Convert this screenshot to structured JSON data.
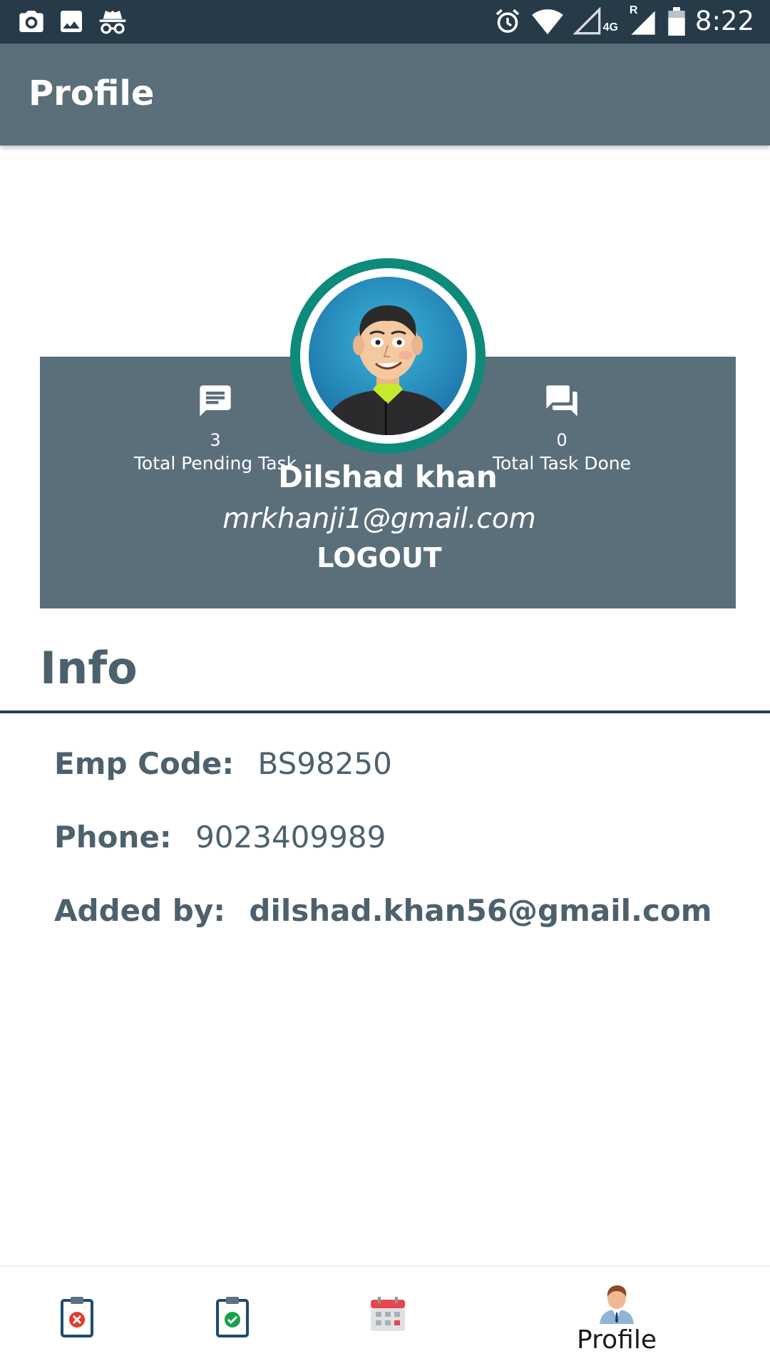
{
  "status_bar": {
    "time": "8:22",
    "network": "4G",
    "roaming": "R",
    "icons": [
      "camera-icon",
      "image-icon",
      "incognito-icon",
      "alarm-icon",
      "wifi-icon",
      "signal-icon",
      "roaming-signal-icon",
      "battery-icon"
    ]
  },
  "app_bar": {
    "title": "Profile"
  },
  "profile": {
    "pending_count": "3",
    "pending_label": "Total Pending Task",
    "done_count": "0",
    "done_label": "Total Task Done",
    "name": "Dilshad khan",
    "email": "mrkhanji1@gmail.com",
    "logout_label": "LOGOUT"
  },
  "info": {
    "title": "Info",
    "emp_code_label": "Emp Code:",
    "emp_code_value": "BS98250",
    "phone_label": "Phone:",
    "phone_value": "9023409989",
    "added_by_label": "Added by:",
    "added_by_value": "dilshad.khan56@gmail.com"
  },
  "bottom_nav": {
    "items": [
      {
        "icon": "clipboard-cancel-icon"
      },
      {
        "icon": "clipboard-check-icon"
      },
      {
        "icon": "calendar-icon"
      },
      {
        "icon": "profile-person-icon",
        "label": "Profile"
      }
    ]
  },
  "colors": {
    "status_bar": "#263a48",
    "app_bar": "#5b6f7a",
    "card": "#5b6f7a",
    "avatar_ring": "#0e8a7a",
    "info_text": "#4d616d"
  }
}
